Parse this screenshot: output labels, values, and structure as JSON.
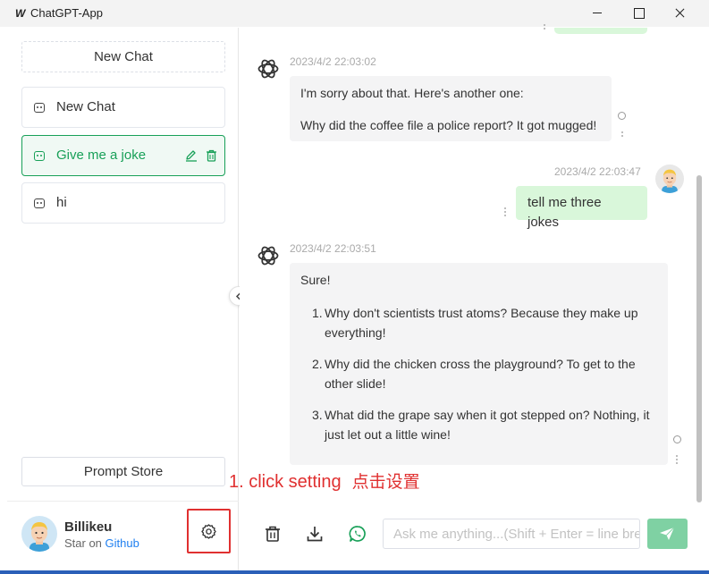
{
  "window": {
    "logo": "W",
    "title": "ChatGPT-App"
  },
  "sidebar": {
    "new_chat_label": "New Chat",
    "items": [
      {
        "label": "New Chat"
      },
      {
        "label": "Give me a joke"
      },
      {
        "label": "hi"
      }
    ],
    "prompt_store_label": "Prompt Store",
    "user": {
      "name": "Billikeu",
      "sub_prefix": "Star on ",
      "sub_link": "Github"
    }
  },
  "chat": {
    "messages": [
      {
        "role": "assistant",
        "time": "2023/4/2 22:03:02",
        "paragraphs": [
          "I'm sorry about that. Here's another one:",
          "Why did the coffee file a police report? It got mugged!"
        ]
      },
      {
        "role": "user",
        "time": "2023/4/2 22:03:47",
        "text": "tell me three jokes"
      },
      {
        "role": "assistant",
        "time": "2023/4/2 22:03:51",
        "intro": "Sure!",
        "list": [
          {
            "n": "1.",
            "text": "Why don't scientists trust atoms? Because they make up everything!"
          },
          {
            "n": "2.",
            "text": "Why did the chicken cross the playground? To get to the other slide!"
          },
          {
            "n": "3.",
            "text": "What did the grape say when it got stepped on? Nothing, it just let out a little wine!"
          }
        ]
      }
    ]
  },
  "composer": {
    "placeholder": "Ask me anything...(Shift + Enter = line break)"
  },
  "annotation": {
    "en": "1. click setting",
    "cn": "点击设置"
  },
  "colors": {
    "accent": "#18a058",
    "user_bubble": "#d9f7da",
    "bot_bubble": "#f4f4f5",
    "send_button": "#7fd1a3",
    "annotation": "#e03030",
    "link": "#2080f0"
  }
}
